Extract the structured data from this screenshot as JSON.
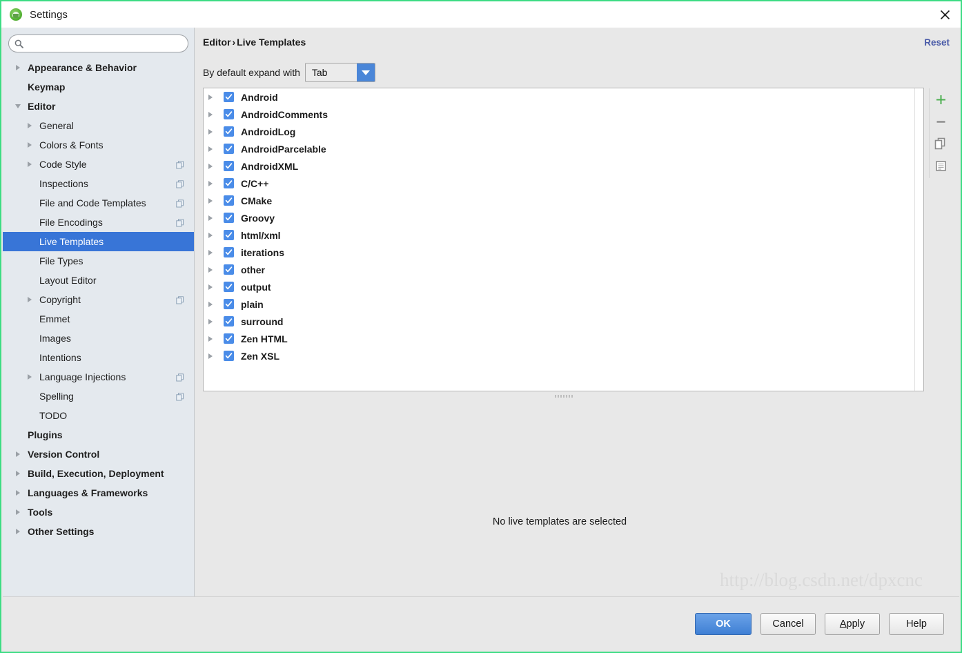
{
  "window": {
    "title": "Settings",
    "app_icon": "android-studio-icon",
    "close_icon": "close-icon",
    "accent_border": "#3ddc84"
  },
  "sidebar": {
    "search": {
      "value": "",
      "placeholder": "",
      "icon": "search-icon"
    },
    "items": [
      {
        "label": "Appearance & Behavior",
        "level": 0,
        "bold": true,
        "twisty": "right",
        "badge": false,
        "selected": false
      },
      {
        "label": "Keymap",
        "level": 0,
        "bold": true,
        "twisty": "none",
        "badge": false,
        "selected": false
      },
      {
        "label": "Editor",
        "level": 0,
        "bold": true,
        "twisty": "down",
        "badge": false,
        "selected": false
      },
      {
        "label": "General",
        "level": 1,
        "bold": false,
        "twisty": "right",
        "badge": false,
        "selected": false
      },
      {
        "label": "Colors & Fonts",
        "level": 1,
        "bold": false,
        "twisty": "right",
        "badge": false,
        "selected": false
      },
      {
        "label": "Code Style",
        "level": 1,
        "bold": false,
        "twisty": "right",
        "badge": true,
        "selected": false
      },
      {
        "label": "Inspections",
        "level": 1,
        "bold": false,
        "twisty": "none",
        "badge": true,
        "selected": false
      },
      {
        "label": "File and Code Templates",
        "level": 1,
        "bold": false,
        "twisty": "none",
        "badge": true,
        "selected": false
      },
      {
        "label": "File Encodings",
        "level": 1,
        "bold": false,
        "twisty": "none",
        "badge": true,
        "selected": false
      },
      {
        "label": "Live Templates",
        "level": 1,
        "bold": false,
        "twisty": "none",
        "badge": false,
        "selected": true
      },
      {
        "label": "File Types",
        "level": 1,
        "bold": false,
        "twisty": "none",
        "badge": false,
        "selected": false
      },
      {
        "label": "Layout Editor",
        "level": 1,
        "bold": false,
        "twisty": "none",
        "badge": false,
        "selected": false
      },
      {
        "label": "Copyright",
        "level": 1,
        "bold": false,
        "twisty": "right",
        "badge": true,
        "selected": false
      },
      {
        "label": "Emmet",
        "level": 1,
        "bold": false,
        "twisty": "none",
        "badge": false,
        "selected": false
      },
      {
        "label": "Images",
        "level": 1,
        "bold": false,
        "twisty": "none",
        "badge": false,
        "selected": false
      },
      {
        "label": "Intentions",
        "level": 1,
        "bold": false,
        "twisty": "none",
        "badge": false,
        "selected": false
      },
      {
        "label": "Language Injections",
        "level": 1,
        "bold": false,
        "twisty": "right",
        "badge": true,
        "selected": false
      },
      {
        "label": "Spelling",
        "level": 1,
        "bold": false,
        "twisty": "none",
        "badge": true,
        "selected": false
      },
      {
        "label": "TODO",
        "level": 1,
        "bold": false,
        "twisty": "none",
        "badge": false,
        "selected": false
      },
      {
        "label": "Plugins",
        "level": 0,
        "bold": true,
        "twisty": "none",
        "badge": false,
        "selected": false
      },
      {
        "label": "Version Control",
        "level": 0,
        "bold": true,
        "twisty": "right",
        "badge": false,
        "selected": false
      },
      {
        "label": "Build, Execution, Deployment",
        "level": 0,
        "bold": true,
        "twisty": "right",
        "badge": false,
        "selected": false
      },
      {
        "label": "Languages & Frameworks",
        "level": 0,
        "bold": true,
        "twisty": "right",
        "badge": false,
        "selected": false
      },
      {
        "label": "Tools",
        "level": 0,
        "bold": true,
        "twisty": "right",
        "badge": false,
        "selected": false
      },
      {
        "label": "Other Settings",
        "level": 0,
        "bold": true,
        "twisty": "right",
        "badge": false,
        "selected": false
      }
    ]
  },
  "main": {
    "breadcrumb": {
      "root": "Editor",
      "separator": "›",
      "leaf": "Live Templates"
    },
    "reset_label": "Reset",
    "expand_label": "By default expand with",
    "expand_value": "Tab",
    "empty_message": "No live templates are selected",
    "watermark": "http://blog.csdn.net/dpxcnc",
    "templates": [
      {
        "label": "Android",
        "checked": true,
        "expanded": false
      },
      {
        "label": "AndroidComments",
        "checked": true,
        "expanded": false
      },
      {
        "label": "AndroidLog",
        "checked": true,
        "expanded": false
      },
      {
        "label": "AndroidParcelable",
        "checked": true,
        "expanded": false
      },
      {
        "label": "AndroidXML",
        "checked": true,
        "expanded": false
      },
      {
        "label": "C/C++",
        "checked": true,
        "expanded": false
      },
      {
        "label": "CMake",
        "checked": true,
        "expanded": false
      },
      {
        "label": "Groovy",
        "checked": true,
        "expanded": false
      },
      {
        "label": "html/xml",
        "checked": true,
        "expanded": false
      },
      {
        "label": "iterations",
        "checked": true,
        "expanded": false
      },
      {
        "label": "other",
        "checked": true,
        "expanded": false
      },
      {
        "label": "output",
        "checked": true,
        "expanded": false
      },
      {
        "label": "plain",
        "checked": true,
        "expanded": false
      },
      {
        "label": "surround",
        "checked": true,
        "expanded": false
      },
      {
        "label": "Zen HTML",
        "checked": true,
        "expanded": false
      },
      {
        "label": "Zen XSL",
        "checked": true,
        "expanded": false
      }
    ],
    "tools": [
      {
        "name": "add-template-button",
        "icon": "plus-icon",
        "color": "#4caf50"
      },
      {
        "name": "remove-template-button",
        "icon": "minus-icon",
        "color": "#8a8a8a"
      },
      {
        "name": "copy-template-button",
        "icon": "copy-icon",
        "color": "#8a8a8a"
      },
      {
        "name": "edit-template-button",
        "icon": "document-icon",
        "color": "#8a8a8a"
      }
    ]
  },
  "footer": {
    "buttons": [
      {
        "label": "OK",
        "primary": true,
        "mnemonic": ""
      },
      {
        "label": "Cancel",
        "primary": false,
        "mnemonic": ""
      },
      {
        "label": "Apply",
        "primary": false,
        "mnemonic": "A"
      },
      {
        "label": "Help",
        "primary": false,
        "mnemonic": ""
      }
    ]
  }
}
